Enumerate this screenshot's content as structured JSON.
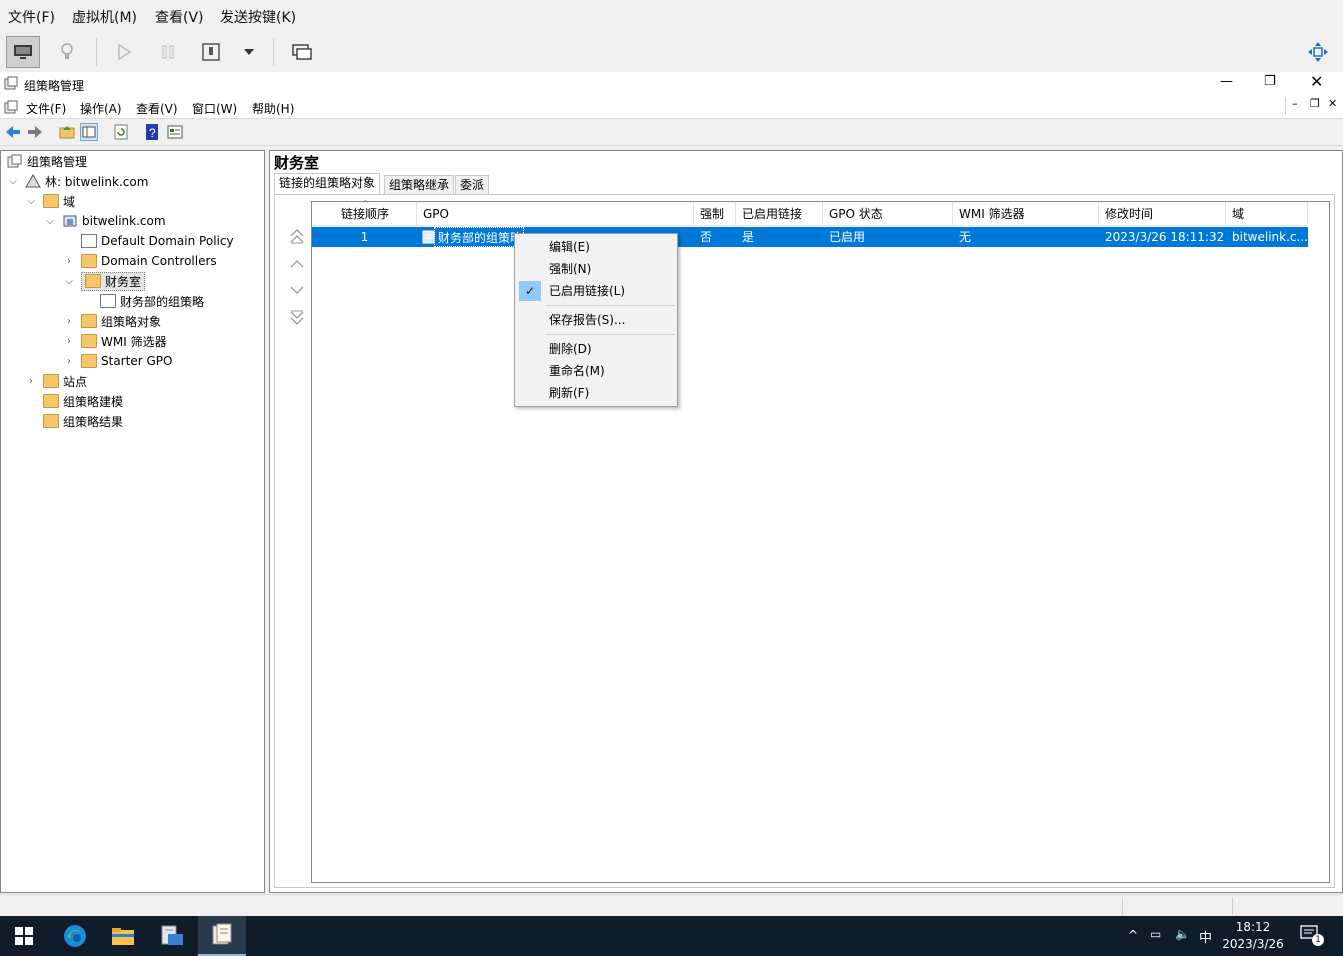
{
  "vm_menu": [
    "文件(F)",
    "虚拟机(M)",
    "查看(V)",
    "发送按键(K)"
  ],
  "mmc": {
    "title": "组策略管理",
    "menu": [
      "文件(F)",
      "操作(A)",
      "查看(V)",
      "窗口(W)",
      "帮助(H)"
    ]
  },
  "tree": {
    "root": "组策略管理",
    "forest": "林: bitwelink.com",
    "domains": "域",
    "domain": "bitwelink.com",
    "default_policy": "Default Domain Policy",
    "domain_controllers": "Domain Controllers",
    "ou": "财务室",
    "ou_gpo": "财务部的组策略",
    "gpo_objects": "组策略对象",
    "wmi": "WMI 筛选器",
    "starter": "Starter GPO",
    "sites": "站点",
    "modeling": "组策略建模",
    "results": "组策略结果"
  },
  "pane": {
    "title": "财务室",
    "tabs": [
      "链接的组策略对象",
      "组策略继承",
      "委派"
    ]
  },
  "table": {
    "headers": [
      "链接顺序",
      "GPO",
      "强制",
      "已启用链接",
      "GPO 状态",
      "WMI 筛选器",
      "修改时间",
      "域"
    ],
    "rows": [
      {
        "order": "1",
        "gpo": "财务部的组策略",
        "enforced": "否",
        "link_enabled": "是",
        "status": "已启用",
        "wmi": "无",
        "modified": "2023/3/26 18:11:32",
        "domain": "bitwelink.c..."
      }
    ]
  },
  "context_menu": {
    "edit": "编辑(E)",
    "enforce": "强制(N)",
    "link_enabled": "已启用链接(L)",
    "save_report": "保存报告(S)...",
    "delete": "删除(D)",
    "rename": "重命名(M)",
    "refresh": "刷新(F)"
  },
  "taskbar": {
    "time": "18:12",
    "date": "2023/3/26",
    "ime": "中",
    "notification_count": "1"
  },
  "colors": {
    "selection": "#0078d7",
    "taskbar": "#101c2a",
    "menu_check": "#91c9f7"
  }
}
